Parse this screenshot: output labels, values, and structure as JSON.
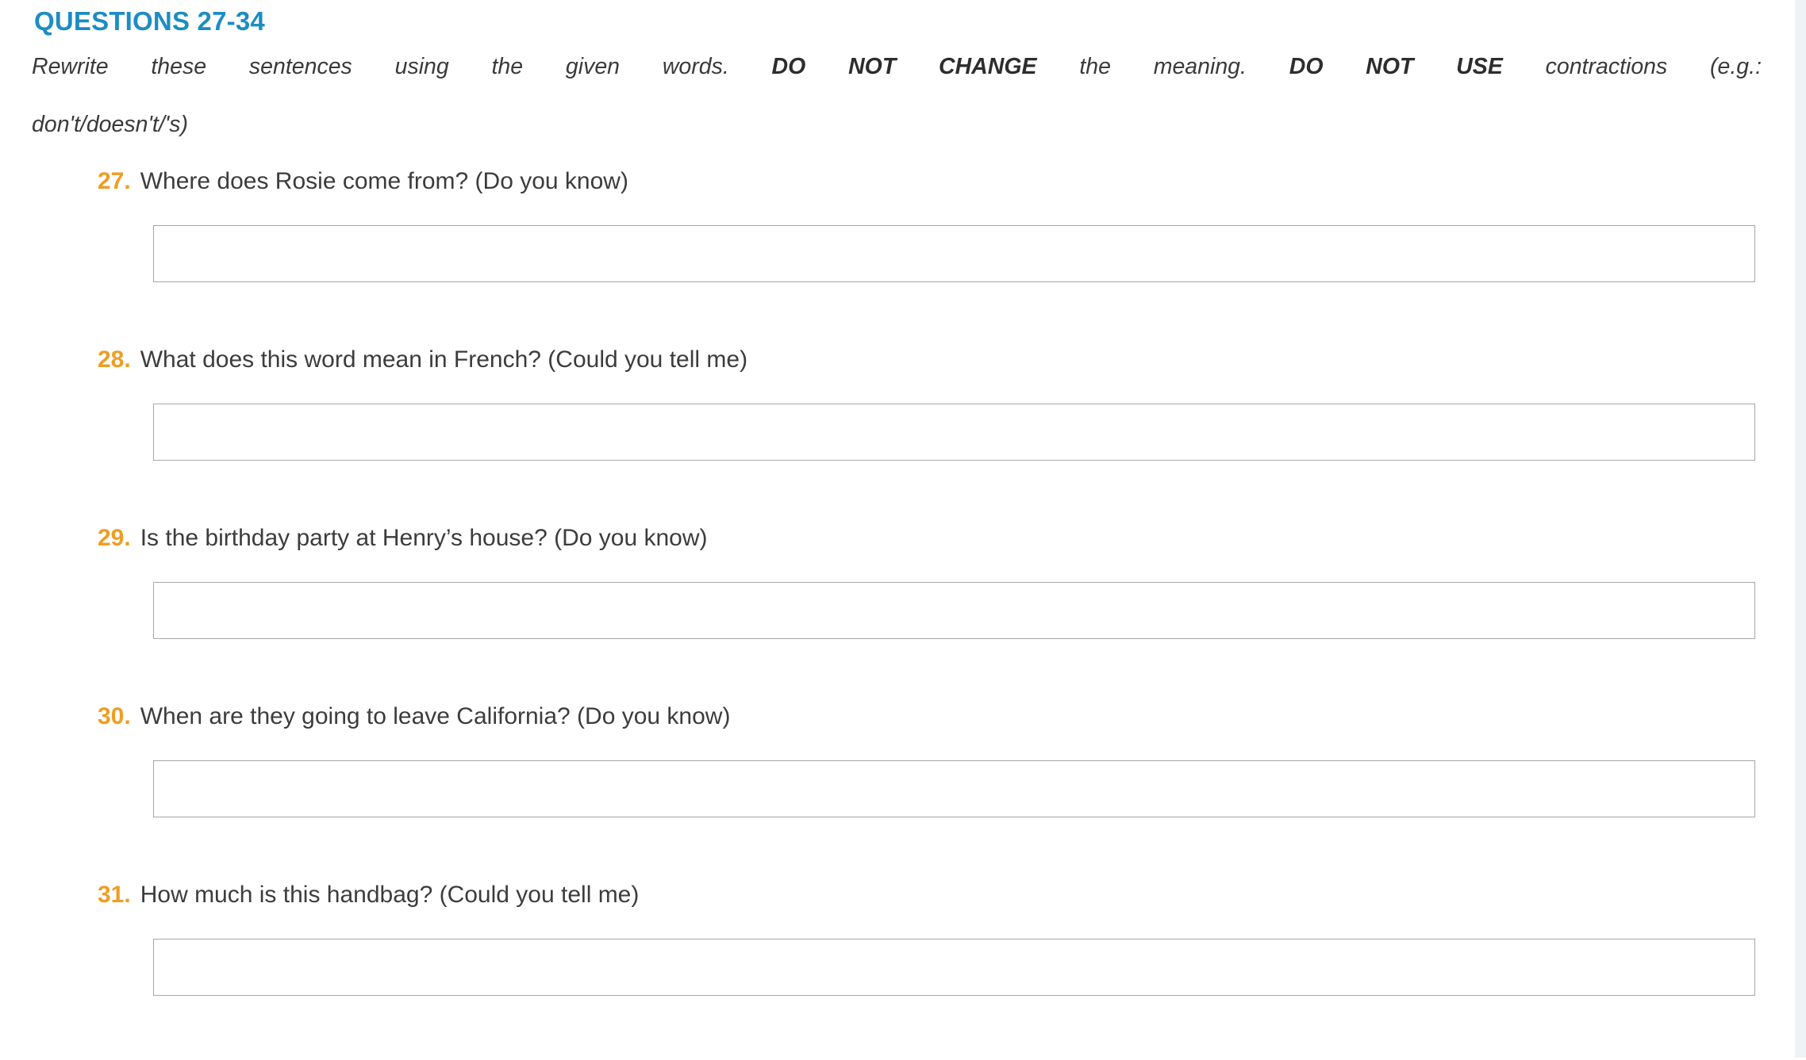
{
  "colors": {
    "heading_blue": "#1c8cc4",
    "number_orange": "#ef9d22",
    "text_gray": "#3c3c3c",
    "input_border": "#a7a7a7",
    "page_gutter": "#eff3f6",
    "page_background": "#ffffff"
  },
  "section": {
    "heading": "QUESTIONS 27-34",
    "instructions": {
      "part1": "Rewrite these sentences using the given words. ",
      "emphasis1": "DO NOT CHANGE",
      "part2": " the meaning. ",
      "emphasis2": "DO NOT USE",
      "part3": " contractions (e.g.:",
      "line2": "don't/doesn't/'s)"
    }
  },
  "questions": [
    {
      "number": "27.",
      "text": "Where does Rosie come from? (Do you know)",
      "answer": "",
      "placeholder": ""
    },
    {
      "number": "28.",
      "text": "What does this word mean in French? (Could you tell me)",
      "answer": "",
      "placeholder": ""
    },
    {
      "number": "29.",
      "text": "Is the birthday party at Henry’s house? (Do you know)",
      "answer": "",
      "placeholder": ""
    },
    {
      "number": "30.",
      "text": "When are they going to leave California? (Do you know)",
      "answer": "",
      "placeholder": ""
    },
    {
      "number": "31.",
      "text": "How much is this handbag? (Could you tell me)",
      "answer": "",
      "placeholder": ""
    }
  ]
}
